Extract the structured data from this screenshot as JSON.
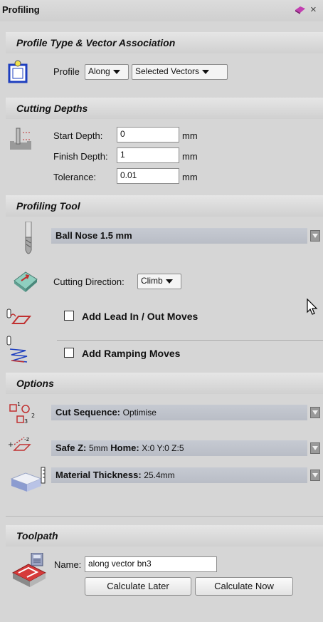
{
  "window": {
    "title": "Profiling"
  },
  "sections": {
    "profile_type": "Profile Type & Vector Association",
    "cutting_depths": "Cutting Depths",
    "profiling_tool": "Profiling Tool",
    "options": "Options",
    "toolpath": "Toolpath"
  },
  "profile": {
    "label": "Profile",
    "side": "Along",
    "selection": "Selected Vectors"
  },
  "depths": {
    "start_label": "Start Depth:",
    "start_value": "0",
    "finish_label": "Finish Depth:",
    "finish_value": "1",
    "tolerance_label": "Tolerance:",
    "tolerance_value": "0.01",
    "unit": "mm"
  },
  "tool": {
    "name": "Ball Nose 1.5 mm",
    "cutting_direction_label": "Cutting Direction:",
    "cutting_direction": "Climb",
    "lead_label": "Add Lead In / Out Moves",
    "ramp_label": "Add Ramping Moves"
  },
  "options": {
    "cut_sequence_label": "Cut Sequence:",
    "cut_sequence_value": "Optimise",
    "safe_z_label": "Safe Z:",
    "safe_z_value": "5mm",
    "home_label": "Home:",
    "home_value": "X:0 Y:0 Z:5",
    "material_label": "Material Thickness:",
    "material_value": "25.4mm"
  },
  "toolpath": {
    "name_label": "Name:",
    "name_value": "along vector bn3",
    "calc_later": "Calculate Later",
    "calc_now": "Calculate Now"
  },
  "colors": {
    "accent_blue": "#1e3fbf",
    "header_bg": "#d0d0d0",
    "bar_bg": "#bfc3cc"
  }
}
